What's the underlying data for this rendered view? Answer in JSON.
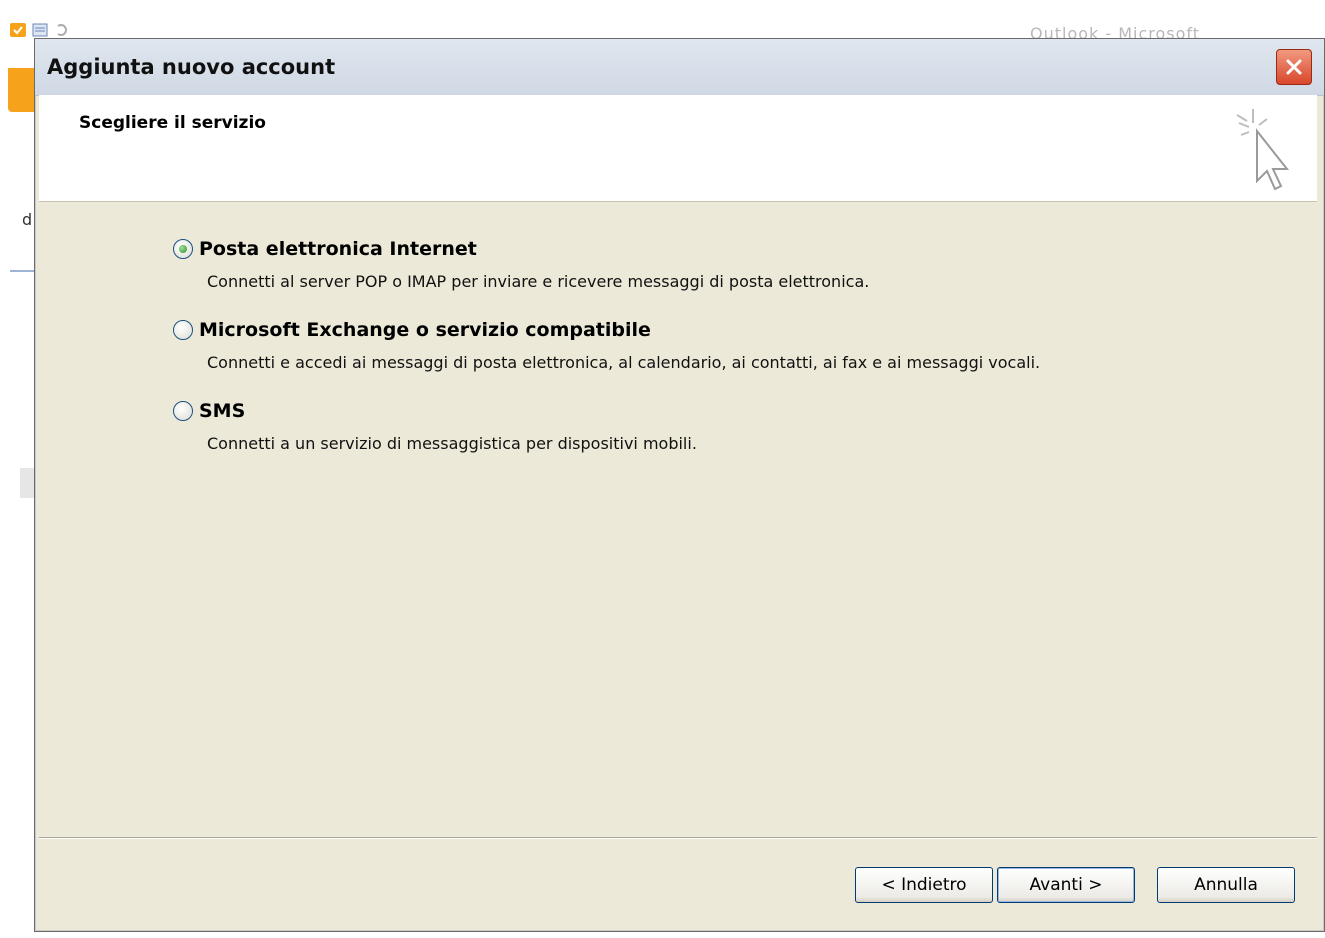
{
  "background_window": {
    "title_fragment": "Outlook - Microsoft",
    "left_letter": "d"
  },
  "dialog": {
    "title": "Aggiunta nuovo account",
    "header_title": "Scegliere il servizio",
    "options": [
      {
        "label": "Posta elettronica Internet",
        "description": "Connetti al server POP o IMAP per inviare e ricevere messaggi di posta elettronica.",
        "selected": true
      },
      {
        "label": "Microsoft Exchange o servizio compatibile",
        "description": "Connetti e accedi ai messaggi di posta elettronica, al calendario, ai contatti, ai fax e ai messaggi vocali.",
        "selected": false
      },
      {
        "label": "SMS",
        "description": "Connetti a un servizio di messaggistica per dispositivi mobili.",
        "selected": false
      }
    ],
    "buttons": {
      "back": "< Indietro",
      "next": "Avanti >",
      "cancel": "Annulla"
    }
  },
  "colors": {
    "dialog_bg": "#ece9d8",
    "selected_radio": "#2a8f23",
    "close_button": "#d9462b"
  },
  "icons": [
    "close-icon",
    "wizard-cursor-icon"
  ]
}
